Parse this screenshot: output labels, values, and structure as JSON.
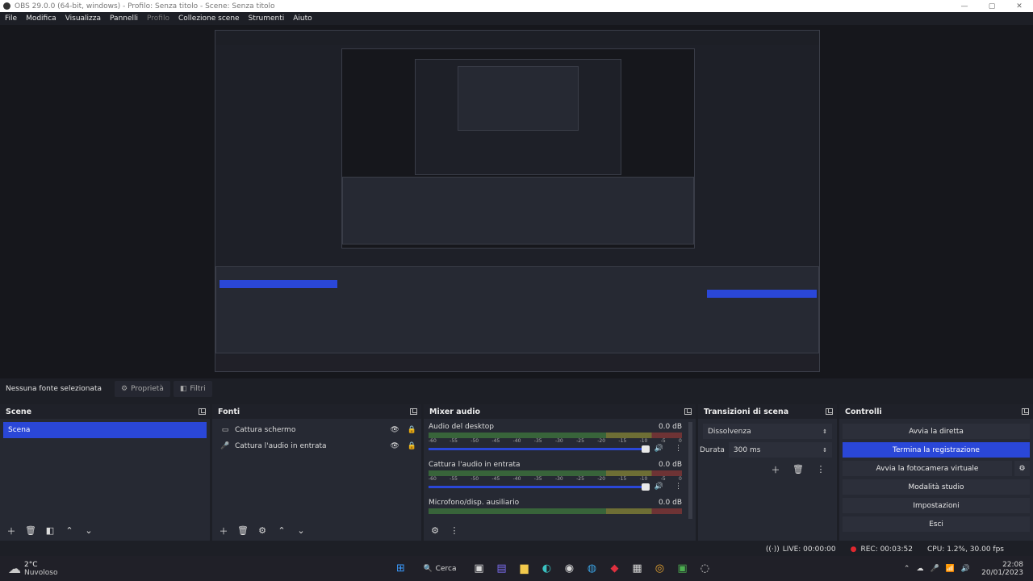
{
  "window": {
    "title": "OBS 29.0.0 (64-bit, windows) - Profilo: Senza titolo - Scene: Senza titolo"
  },
  "menu": [
    "File",
    "Modifica",
    "Visualizza",
    "Pannelli",
    "Profilo",
    "Collezione scene",
    "Strumenti",
    "Aiuto"
  ],
  "source_bar": {
    "label": "Nessuna fonte selezionata",
    "properties": "Proprietà",
    "filters": "Filtri"
  },
  "scenes": {
    "title": "Scene",
    "items": [
      "Scena"
    ]
  },
  "sources": {
    "title": "Fonti",
    "items": [
      {
        "name": "Cattura schermo",
        "icon": "monitor-icon"
      },
      {
        "name": "Cattura l'audio in entrata",
        "icon": "microphone-icon"
      }
    ]
  },
  "mixer": {
    "title": "Mixer audio",
    "ticks": [
      "-60",
      "-55",
      "-50",
      "-45",
      "-40",
      "-35",
      "-30",
      "-25",
      "-20",
      "-15",
      "-10",
      "-5",
      "0"
    ],
    "channels": [
      {
        "name": "Audio del desktop",
        "db": "0.0 dB"
      },
      {
        "name": "Cattura l'audio in entrata",
        "db": "0.0 dB"
      },
      {
        "name": "Microfono/disp. ausiliario",
        "db": "0.0 dB"
      }
    ]
  },
  "transitions": {
    "title": "Transizioni di scena",
    "selected": "Dissolvenza",
    "duration_label": "Durata",
    "duration_value": "300 ms"
  },
  "controls": {
    "title": "Controlli",
    "buttons": [
      "Avvia la diretta",
      "Termina la registrazione",
      "Avvia la fotocamera virtuale",
      "Modalità studio",
      "Impostazioni",
      "Esci"
    ]
  },
  "status": {
    "live": "LIVE: 00:00:00",
    "rec": "REC: 00:03:52",
    "cpu": "CPU: 1.2%, 30.00 fps"
  },
  "taskbar": {
    "weather_temp": "2°C",
    "weather_desc": "Nuvoloso",
    "search": "Cerca",
    "time": "22:08",
    "date": "20/01/2023"
  },
  "colors": {
    "accent": "#2a47d8",
    "rec_dot": "#e0282f"
  }
}
